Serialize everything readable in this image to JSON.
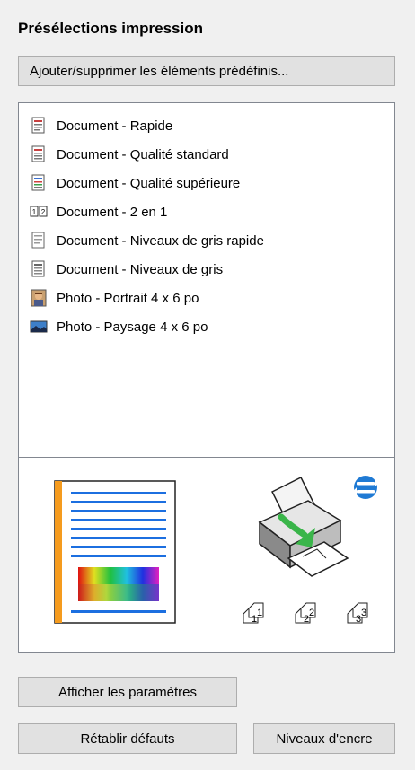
{
  "title": "Présélections impression",
  "add_remove_button": "Ajouter/supprimer les éléments prédéfinis...",
  "presets": [
    {
      "label": "Document - Rapide",
      "icon": "document-fast-icon"
    },
    {
      "label": "Document - Qualité standard",
      "icon": "document-standard-icon"
    },
    {
      "label": "Document - Qualité supérieure",
      "icon": "document-high-quality-icon"
    },
    {
      "label": "Document - 2 en 1",
      "icon": "two-in-one-icon"
    },
    {
      "label": "Document - Niveaux de gris rapide",
      "icon": "grayscale-fast-icon"
    },
    {
      "label": "Document - Niveaux de gris",
      "icon": "grayscale-icon"
    },
    {
      "label": "Photo - Portrait 4 x 6 po",
      "icon": "photo-portrait-icon"
    },
    {
      "label": "Photo - Paysage 4 x 6 po",
      "icon": "photo-landscape-icon"
    }
  ],
  "preview": {
    "collate_numbers": [
      "1",
      "1",
      "2",
      "2",
      "3",
      "3"
    ],
    "colors": {
      "accent": "#f59b1e",
      "line": "#1c6fe0",
      "arrow": "#3ab54a",
      "badge": "#1f7ad4"
    }
  },
  "buttons": {
    "show_settings": "Afficher les paramètres",
    "restore_defaults": "Rétablir défauts",
    "ink_levels": "Niveaux d'encre"
  }
}
